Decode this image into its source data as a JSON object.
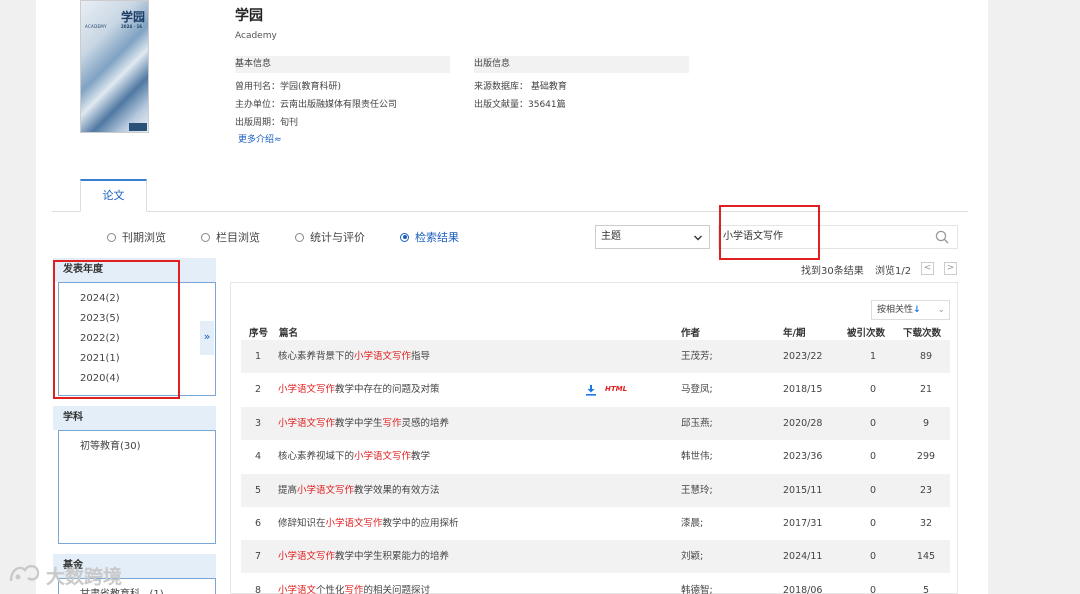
{
  "journal": {
    "cover": {
      "title": "学园",
      "subtitle_en": "ACADEMY",
      "issue": "2024 · 16"
    },
    "title": "学园",
    "title_en": "Academy",
    "basic_info": {
      "header": "基本信息",
      "former_name": "曾用刊名：学园(教育科研)",
      "sponsor": "主办单位：云南出版融媒体有限责任公司",
      "cycle": "出版周期：旬刊",
      "more": "更多介绍≈"
    },
    "publish_info": {
      "header": "出版信息",
      "source_db": "来源数据库：  基础教育",
      "count": "出版文献量：35641篇"
    }
  },
  "tabs": [
    {
      "label": "论文",
      "active": true
    }
  ],
  "browse_modes": [
    {
      "label": "刊期浏览",
      "selected": false
    },
    {
      "label": "栏目浏览",
      "selected": false
    },
    {
      "label": "统计与评价",
      "selected": false
    },
    {
      "label": "检索结果",
      "selected": true
    }
  ],
  "search": {
    "field": "主题",
    "query": "小学语文写作"
  },
  "results_meta": {
    "found": "找到30条结果",
    "browse": "浏览1/2",
    "prev": "<",
    "next": ">"
  },
  "facets": {
    "year": {
      "title": "发表年度",
      "items": [
        "2024(2)",
        "2023(5)",
        "2022(2)",
        "2021(1)",
        "2020(4)"
      ],
      "expand": "»"
    },
    "subject": {
      "title": "学科",
      "items": [
        "初等教育(30)"
      ]
    },
    "fund": {
      "title": "基金",
      "items": [
        "甘肃省教育科...(1)"
      ]
    }
  },
  "sort": {
    "label": "按相关性",
    "arrow": "↓"
  },
  "table": {
    "headers": {
      "index": "序号",
      "title": "篇名",
      "author": "作者",
      "issue": "年/期",
      "cited": "被引次数",
      "downloads": "下载次数"
    },
    "rows": [
      {
        "index": "1",
        "parts": [
          {
            "t": "核心素养背景下的",
            "hl": false
          },
          {
            "t": "小学语文写作",
            "hl": true
          },
          {
            "t": "指导",
            "hl": false
          }
        ],
        "author": "王茂芳;",
        "issue": "2023/22",
        "cited": "1",
        "downloads": "89"
      },
      {
        "index": "2",
        "parts": [
          {
            "t": "小学语文写作",
            "hl": true
          },
          {
            "t": "教学中存在的问题及对策",
            "hl": false
          }
        ],
        "author": "马登凤;",
        "issue": "2018/15",
        "cited": "0",
        "downloads": "21",
        "html_label": "HTML"
      },
      {
        "index": "3",
        "parts": [
          {
            "t": "小学语文写作",
            "hl": true
          },
          {
            "t": "教学中学生",
            "hl": false
          },
          {
            "t": "写作",
            "hl": true
          },
          {
            "t": "灵感的培养",
            "hl": false
          }
        ],
        "author": "邱玉燕;",
        "issue": "2020/28",
        "cited": "0",
        "downloads": "9"
      },
      {
        "index": "4",
        "parts": [
          {
            "t": "核心素养视域下的",
            "hl": false
          },
          {
            "t": "小学语文写作",
            "hl": true
          },
          {
            "t": "教学",
            "hl": false
          }
        ],
        "author": "韩世伟;",
        "issue": "2023/36",
        "cited": "0",
        "downloads": "299"
      },
      {
        "index": "5",
        "parts": [
          {
            "t": "提高",
            "hl": false
          },
          {
            "t": "小学语文写作",
            "hl": true
          },
          {
            "t": "教学效果的有效方法",
            "hl": false
          }
        ],
        "author": "王慧玲;",
        "issue": "2015/11",
        "cited": "0",
        "downloads": "23"
      },
      {
        "index": "6",
        "parts": [
          {
            "t": "修辞知识在",
            "hl": false
          },
          {
            "t": "小学语文写作",
            "hl": true
          },
          {
            "t": "教学中的应用探析",
            "hl": false
          }
        ],
        "author": "漆晨;",
        "issue": "2017/31",
        "cited": "0",
        "downloads": "32"
      },
      {
        "index": "7",
        "parts": [
          {
            "t": "小学语文写作",
            "hl": true
          },
          {
            "t": "教学中学生积累能力的培养",
            "hl": false
          }
        ],
        "author": "刘颖;",
        "issue": "2024/11",
        "cited": "0",
        "downloads": "145"
      },
      {
        "index": "8",
        "parts": [
          {
            "t": "小学语文",
            "hl": true
          },
          {
            "t": "个性化",
            "hl": false
          },
          {
            "t": "写作",
            "hl": true
          },
          {
            "t": "的相关问题探讨",
            "hl": false
          }
        ],
        "author": "韩德智;",
        "issue": "2018/06",
        "cited": "0",
        "downloads": "5"
      }
    ]
  },
  "watermark": "大数跨境",
  "colors": {
    "link_blue": "#1a5fc0",
    "highlight_red": "#e02020",
    "annotation_red": "#e02020",
    "facet_bg": "#e4eef9"
  }
}
